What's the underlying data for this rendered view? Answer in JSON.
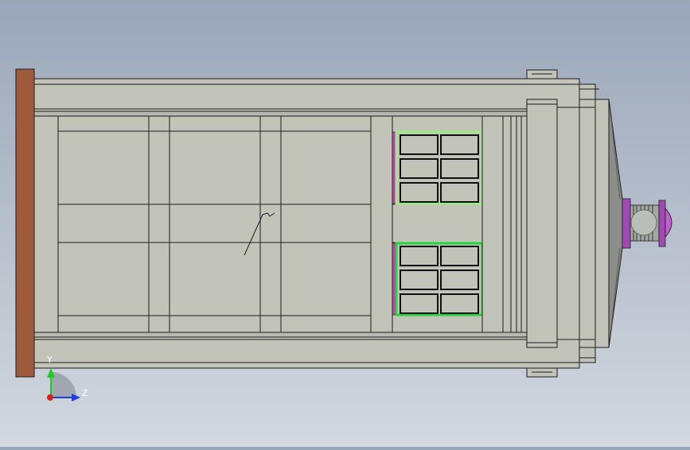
{
  "viewport": {
    "background_top": "#9aa6b9",
    "background_bottom": "#d3d8df"
  },
  "model": {
    "colors": {
      "body": "#c3c4b9",
      "body_dark": "#a9aa9f",
      "line": "#1c1c1c",
      "end_plate": "#a05a3c",
      "window_frame_upper": "#9dea85",
      "window_frame_lower": "#1fd63a",
      "window_pane": "#c3c4b9",
      "seal_strip": "#c23bb0",
      "nozzle_ring": "#a24ab4",
      "nozzle_body": "#a2a7a1"
    },
    "window_upper_panes": 6,
    "window_lower_panes": 6
  },
  "triad": {
    "y_label": "Y",
    "z_label": "Z",
    "y_color": "#1fcc1f",
    "z_color": "#1f3fd8",
    "x_color": "#d81f1f"
  }
}
